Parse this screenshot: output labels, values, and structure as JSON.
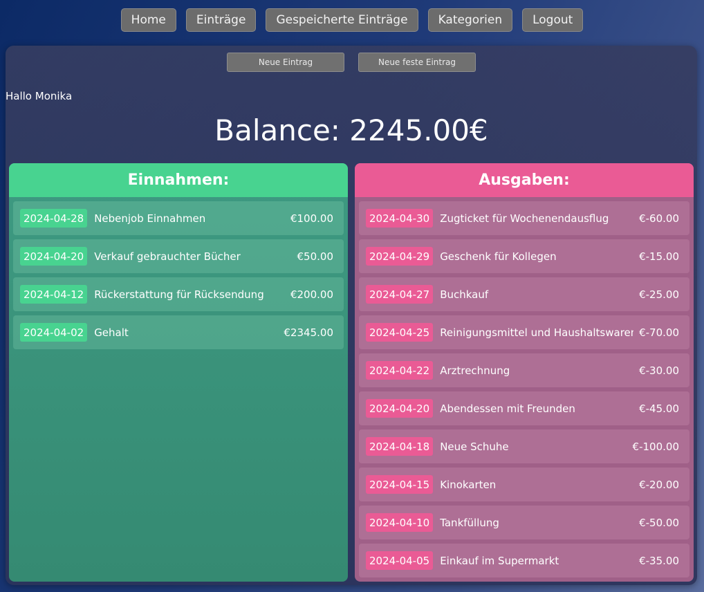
{
  "nav": {
    "items": [
      {
        "label": "Home"
      },
      {
        "label": "Einträge"
      },
      {
        "label": "Gespeicherte Einträge"
      },
      {
        "label": "Kategorien"
      },
      {
        "label": "Logout"
      }
    ]
  },
  "actions": {
    "new_entry": "Neue Eintrag",
    "new_fixed_entry": "Neue feste Eintrag"
  },
  "greeting": "Hallo Monika",
  "balance": "Balance: 2245.00€",
  "income": {
    "title": "Einnahmen:",
    "color": "#48d390",
    "entries": [
      {
        "date": "2024-04-28",
        "description": "Nebenjob Einnahmen",
        "amount": "€100.00"
      },
      {
        "date": "2024-04-20",
        "description": "Verkauf gebrauchter Bücher",
        "amount": "€50.00"
      },
      {
        "date": "2024-04-12",
        "description": "Rückerstattung für Rücksendung",
        "amount": "€200.00"
      },
      {
        "date": "2024-04-02",
        "description": "Gehalt",
        "amount": "€2345.00"
      }
    ]
  },
  "expenses": {
    "title": "Ausgaben:",
    "color": "#ea5b95",
    "entries": [
      {
        "date": "2024-04-30",
        "description": "Zugticket für Wochenendausflug",
        "amount": "€-60.00"
      },
      {
        "date": "2024-04-29",
        "description": "Geschenk für Kollegen",
        "amount": "€-15.00"
      },
      {
        "date": "2024-04-27",
        "description": "Buchkauf",
        "amount": "€-25.00"
      },
      {
        "date": "2024-04-25",
        "description": "Reinigungsmittel und Haushaltswaren",
        "amount": "€-70.00"
      },
      {
        "date": "2024-04-22",
        "description": "Arztrechnung",
        "amount": "€-30.00"
      },
      {
        "date": "2024-04-20",
        "description": "Abendessen mit Freunden",
        "amount": "€-45.00"
      },
      {
        "date": "2024-04-18",
        "description": "Neue Schuhe",
        "amount": "€-100.00"
      },
      {
        "date": "2024-04-15",
        "description": "Kinokarten",
        "amount": "€-20.00"
      },
      {
        "date": "2024-04-10",
        "description": "Tankfüllung",
        "amount": "€-50.00"
      },
      {
        "date": "2024-04-05",
        "description": "Einkauf im Supermarkt",
        "amount": "€-35.00"
      }
    ]
  }
}
